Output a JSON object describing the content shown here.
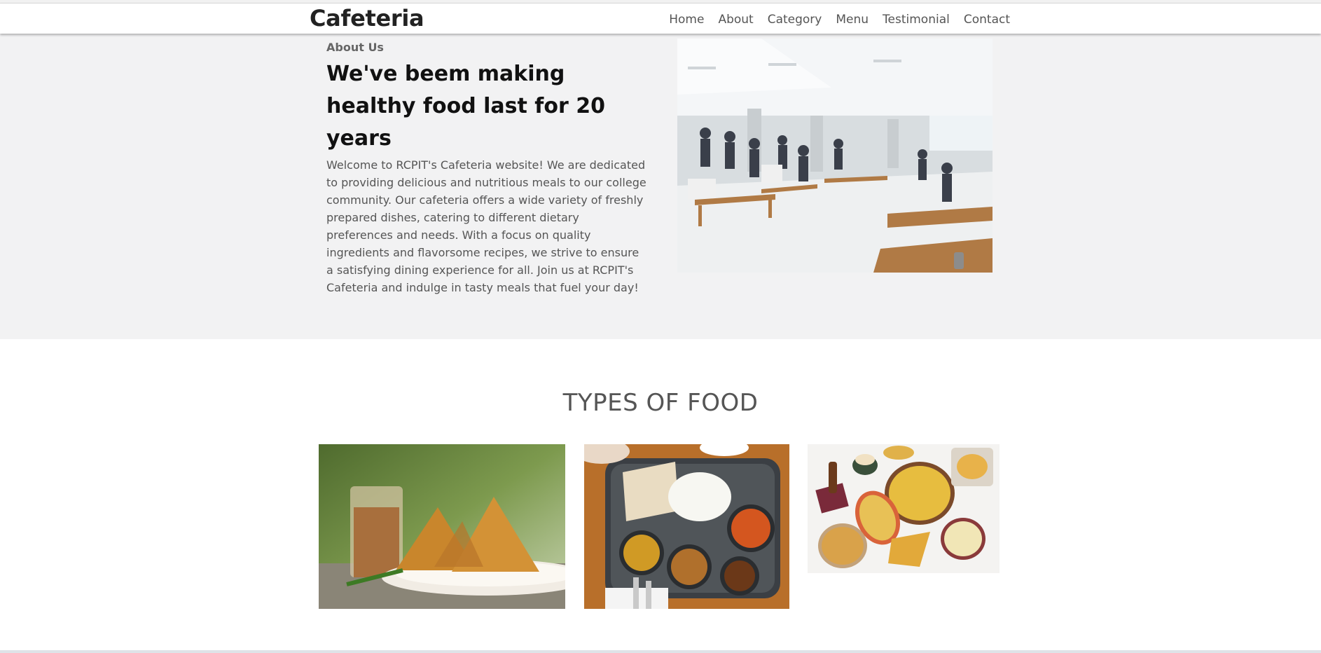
{
  "navbar": {
    "brand": "Cafeteria",
    "links": [
      "Home",
      "About",
      "Category",
      "Menu",
      "Testimonial",
      "Contact"
    ]
  },
  "about": {
    "eyebrow": "About Us",
    "heading": "We've beem making healthy food last for 20 years",
    "body": "Welcome to RCPIT's Cafeteria website! We are dedicated to providing delicious and nutritious meals to our college community. Our cafeteria offers a wide variety of freshly prepared dishes, catering to different dietary preferences and needs. With a focus on quality ingredients and flavorsome recipes, we strive to ensure a satisfying dining experience for all. Join us at RCPIT's Cafeteria and indulge in tasty meals that fuel your day!"
  },
  "types": {
    "title": "TYPES OF FOOD"
  },
  "colors": {
    "about_bg": "#f2f2f3",
    "text_dark": "#111111",
    "text_muted": "#555555"
  }
}
